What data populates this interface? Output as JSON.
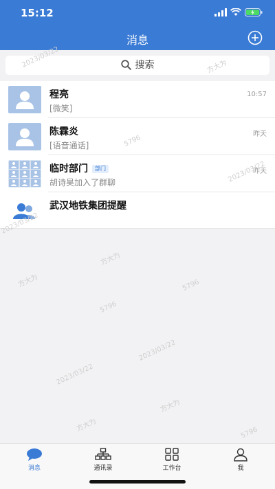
{
  "status_bar": {
    "time": "15:12"
  },
  "header": {
    "title": "消息"
  },
  "search": {
    "placeholder": "搜索"
  },
  "conversations": [
    {
      "name": "程亮",
      "preview": "[微笑]",
      "time": "10:57",
      "avatar": "person-avatar-icon"
    },
    {
      "name": "陈霖炎",
      "preview": "[语音通话]",
      "time": "昨天",
      "avatar": "person-avatar-icon"
    },
    {
      "name": "临时部门",
      "badge": "部门",
      "preview": "胡诗昊加入了群聊",
      "time": "昨天",
      "avatar": "group-grid-avatar-icon"
    },
    {
      "name": "武汉地铁集团提醒",
      "preview": "",
      "time": "",
      "avatar": "people-icon"
    }
  ],
  "tabbar": {
    "tabs": [
      {
        "label": "消息",
        "icon": "chat-bubble-icon",
        "active": true
      },
      {
        "label": "通讯录",
        "icon": "org-chart-icon",
        "active": false
      },
      {
        "label": "工作台",
        "icon": "grid-apps-icon",
        "active": false
      },
      {
        "label": "我",
        "icon": "person-icon",
        "active": false
      }
    ]
  },
  "watermark": {
    "name": "方大为",
    "id": "5796",
    "date": "2023/03/22"
  },
  "colors": {
    "brand": "#3a7bd5",
    "background": "#f2f2f4"
  }
}
